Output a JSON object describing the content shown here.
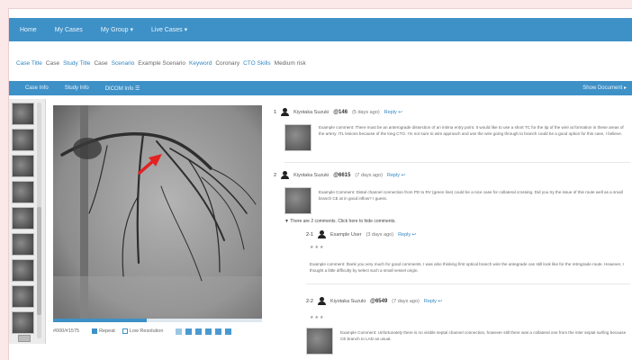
{
  "nav": {
    "items": [
      "Home",
      "My Cases",
      "My Group ▾",
      "Live Cases ▾"
    ]
  },
  "breadcrumb": [
    {
      "label": "Case Title",
      "value": "Case"
    },
    {
      "label": "Study Title",
      "value": "Case"
    },
    {
      "label": "Scenario",
      "value": "Example Scenario"
    },
    {
      "label": "Keyword",
      "value": "Coronary"
    },
    {
      "label": "CTO Skills",
      "value": "Medium risk"
    }
  ],
  "subtoolbar": {
    "items": [
      "Case Info",
      "Study Info",
      "DICOM Info ☰"
    ],
    "right": "Show Document ▸"
  },
  "viewer": {
    "frame_counter": "#000/#1575",
    "progress": 0.45,
    "repeat_label": "Repeat",
    "repeat_checked": true,
    "low_res_label": "Low Resolution",
    "low_res_checked": false,
    "annotation_arrow_color": "#e32222"
  },
  "comments": [
    {
      "number": "1",
      "author": "Kiyotaka Suzuki",
      "score": "@146",
      "time": "(5 days ago)",
      "reply": "Reply ↩",
      "text": "Example comment: There must be an anterograde dissection of an intima entry point. It would like to use a short TC for the tip of the wire at formation in these areas of the artery. ITL lesions because of the long CTO. I'm not sure to wire approach and use the wire going through to branch could be a good option for this case, I believe."
    },
    {
      "number": "2",
      "author": "Kiyotaka Suzuki",
      "score": "@6615",
      "time": "(7 days ago)",
      "reply": "Reply ↩",
      "text": "Example Comment: Distal channel connection from PD to RV (green line) could be a nice case for collateral crossing. Did you try the issue of this route well as a small branch CE at in good inflow? I guess."
    }
  ],
  "replies_toggle": "▼ There are 2 comments. Click here to hide comments.",
  "replies": [
    {
      "number": "2-1",
      "author": "Example User",
      "time": "(3 days ago)",
      "reply": "Reply ↩",
      "stars": "★★★",
      "text": "Example comment: thank you very much for good comments. I was also thinking first optical branch wire the antegrade can still look like for the retrograde route. However, I thought a little difficulty by select such a small vessel origin."
    },
    {
      "number": "2-2",
      "author": "Kiyotaka Suzuki",
      "score": "@6549",
      "time": "(7 days ago)",
      "reply": "Reply ↩",
      "stars": "★★★",
      "text": "Example Comment: Unfortunately there is no visible septal channel connection, however still there was a collateral one from the inter septal surfing because CE branch to LAD as usual."
    }
  ]
}
